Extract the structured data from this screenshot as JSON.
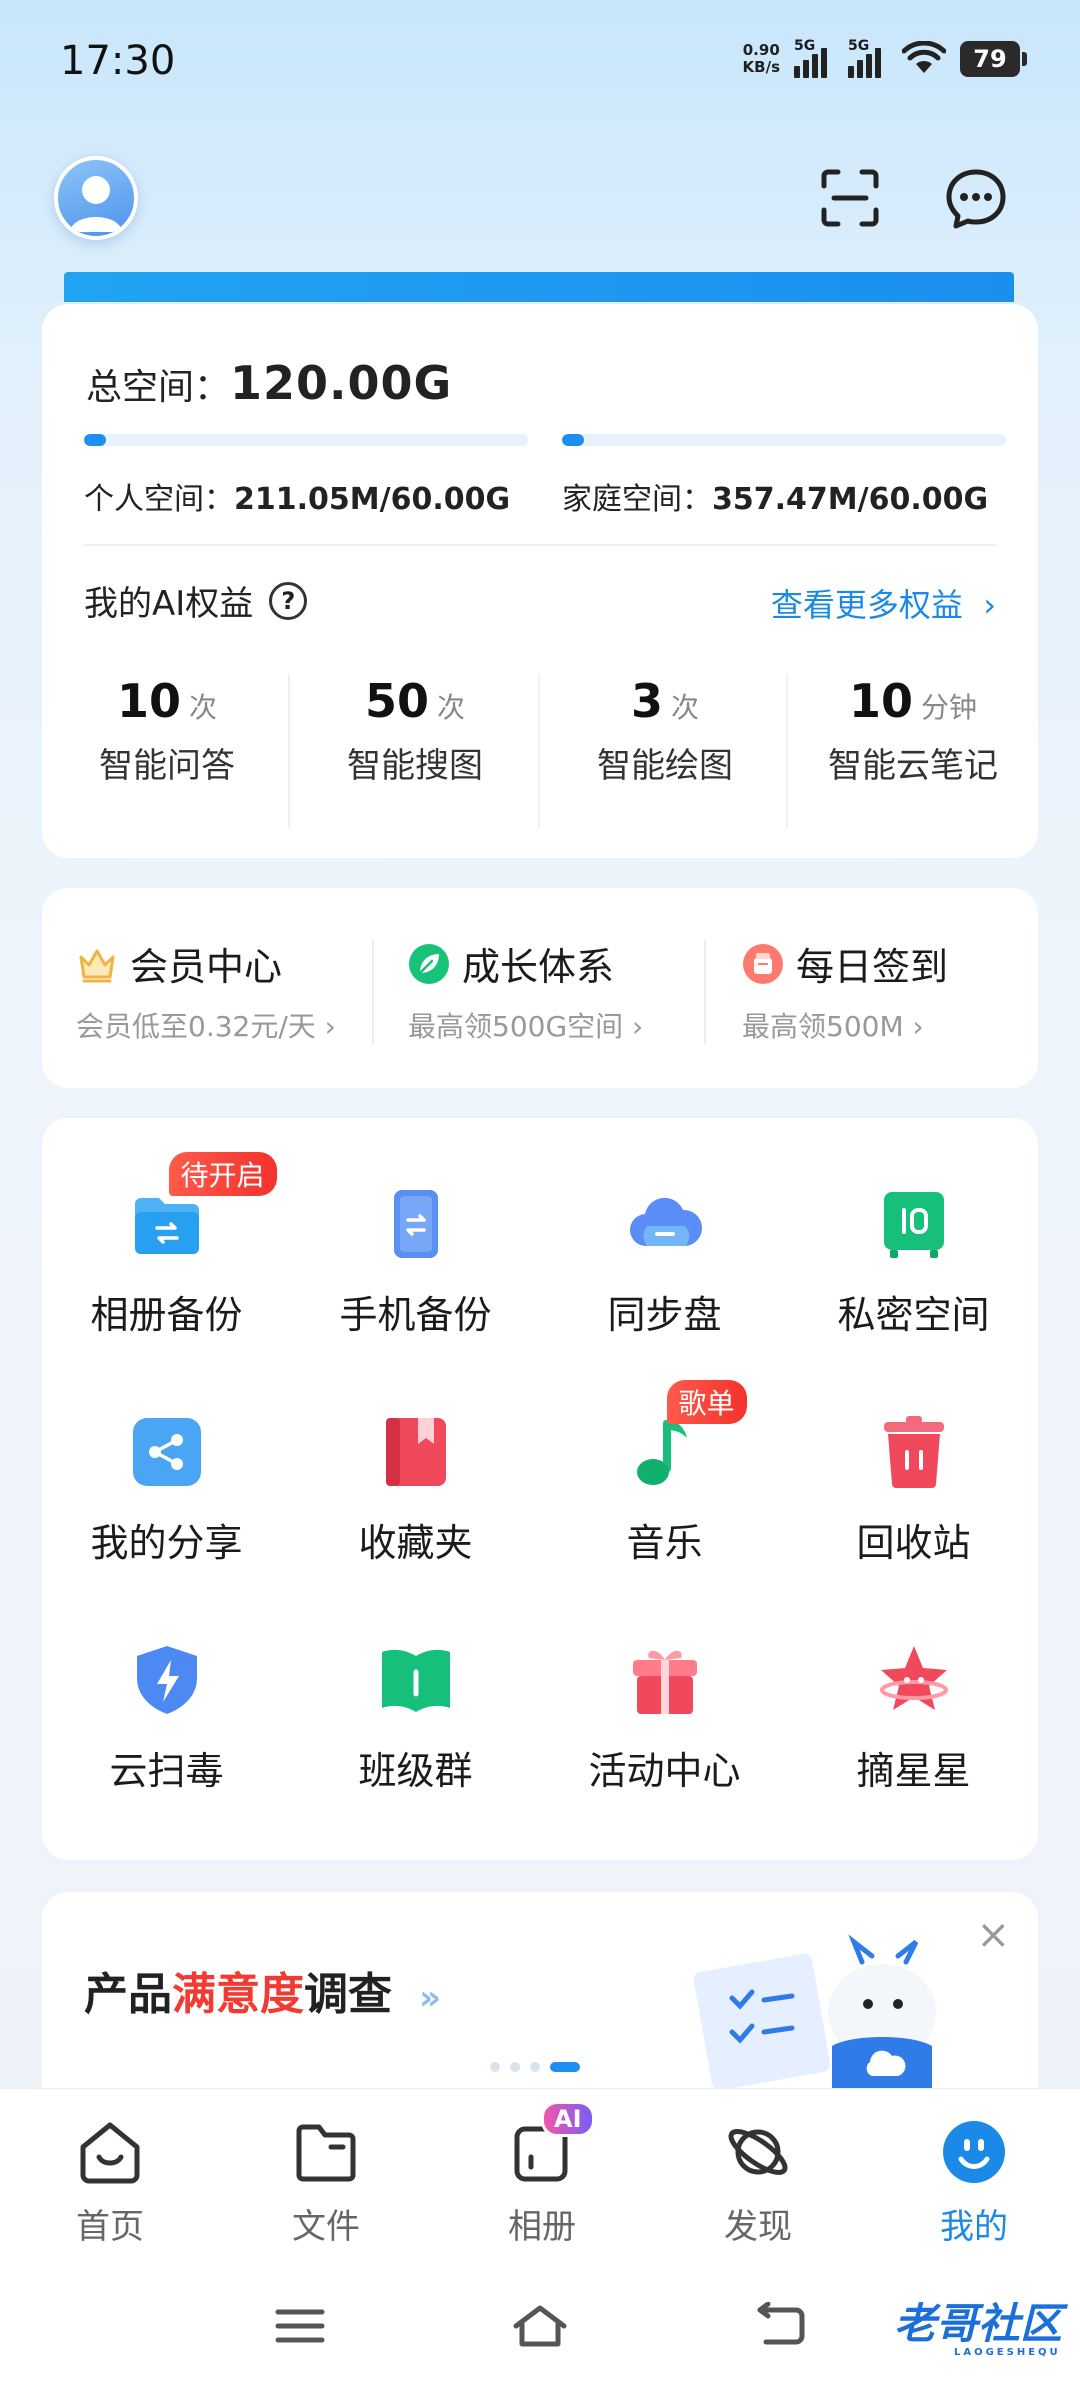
{
  "status_bar": {
    "time": "17:30",
    "net_speed_value": "0.90",
    "net_speed_unit": "KB/s",
    "sim1": "5G",
    "sim2": "5G",
    "battery": "79"
  },
  "storage": {
    "total_label": "总空间：",
    "total_value": "120.00G",
    "personal_label": "个人空间：",
    "personal_value": "211.05M/60.00G",
    "personal_progress": 0.005,
    "family_label": "家庭空间：",
    "family_value": "357.47M/60.00G",
    "family_progress": 0.006
  },
  "ai_benefits": {
    "title": "我的AI权益",
    "more": "查看更多权益",
    "items": [
      {
        "count": "10",
        "unit": "次",
        "name": "智能问答"
      },
      {
        "count": "50",
        "unit": "次",
        "name": "智能搜图"
      },
      {
        "count": "3",
        "unit": "次",
        "name": "智能绘图"
      },
      {
        "count": "10",
        "unit": "分钟",
        "name": "智能云笔记"
      }
    ]
  },
  "member": [
    {
      "title": "会员中心",
      "sub": "会员低至0.32元/天 ›"
    },
    {
      "title": "成长体系",
      "sub": "最高领500G空间 ›"
    },
    {
      "title": "每日签到",
      "sub": "最高领500M ›"
    }
  ],
  "grid": [
    {
      "label": "相册备份",
      "icon": "photo-backup-icon",
      "tag": "待开启"
    },
    {
      "label": "手机备份",
      "icon": "phone-backup-icon"
    },
    {
      "label": "同步盘",
      "icon": "sync-cloud-icon"
    },
    {
      "label": "私密空间",
      "icon": "safe-icon"
    },
    {
      "label": "我的分享",
      "icon": "share-icon"
    },
    {
      "label": "收藏夹",
      "icon": "bookmark-icon"
    },
    {
      "label": "音乐",
      "icon": "music-icon",
      "tag": "歌单"
    },
    {
      "label": "回收站",
      "icon": "trash-icon"
    },
    {
      "label": "云扫毒",
      "icon": "antivirus-shield-icon"
    },
    {
      "label": "班级群",
      "icon": "class-group-icon"
    },
    {
      "label": "活动中心",
      "icon": "gift-icon"
    },
    {
      "label": "摘星星",
      "icon": "star-icon"
    }
  ],
  "survey": {
    "title_a": "产品",
    "title_b": "满意度",
    "title_c": "调查",
    "close": "×"
  },
  "tabs": [
    {
      "label": "首页",
      "icon": "home-icon"
    },
    {
      "label": "文件",
      "icon": "folder-icon"
    },
    {
      "label": "相册",
      "icon": "album-icon",
      "badge": "AI"
    },
    {
      "label": "发现",
      "icon": "discover-planet-icon"
    },
    {
      "label": "我的",
      "icon": "profile-smile-icon",
      "active": true
    }
  ],
  "watermark": {
    "title": "老哥社区",
    "sub": "LAOGESHEQU"
  },
  "colors": {
    "accent": "#1a8ae6",
    "tag_red": "#f3322c"
  }
}
